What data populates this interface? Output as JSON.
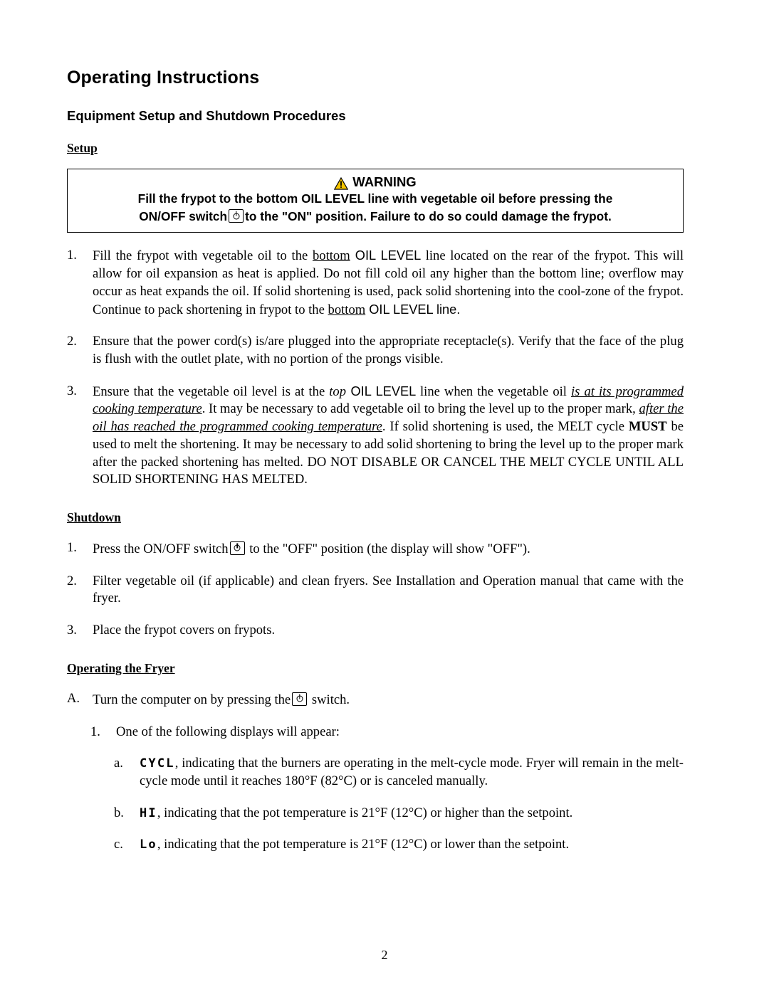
{
  "document": {
    "title": "Operating Instructions",
    "subtitle": "Equipment Setup and Shutdown Procedures",
    "section_setup": "Setup",
    "section_shutdown": "Shutdown",
    "section_operating": "Operating the Fryer",
    "page_number": "2"
  },
  "warning": {
    "heading": "WARNING",
    "icon": "warning-triangle-icon",
    "line1_a": "Fill the frypot to the bottom OIL LEVEL line with vegetable oil before pressing the",
    "line2_a": "ON/OFF switch",
    "line2_b": "to the \"ON\" position.  Failure to do so could damage the frypot."
  },
  "setup_items": [
    {
      "marker": "1.",
      "pre": "Fill the frypot with vegetable oil to the ",
      "u1": "bottom",
      "mid1": " OIL LEVEL ",
      "rest1": "line located on the rear of the frypot. This will allow for oil expansion as heat is applied.  Do not fill cold oil any higher than the bottom line; overflow may occur as heat expands the oil.  If solid shortening is used, pack solid shortening into the cool-zone of the frypot.  Continue to pack shortening in frypot to the ",
      "u2": "bottom",
      "rest2": " OIL LEVEL line."
    },
    {
      "marker": "2.",
      "text": "Ensure that the power cord(s) is/are plugged into the appropriate receptacle(s).  Verify that the face of the plug is flush with the outlet plate, with no portion of the prongs visible."
    },
    {
      "marker": "3.",
      "p1": "Ensure that the vegetable oil level is at the ",
      "i1": "top",
      "p2": " OIL LEVEL ",
      "p3": "line when the vegetable oil ",
      "i2": "is at its programmed cooking temperature",
      "p4": ".  It may be necessary to add vegetable oil to bring the level up to the proper mark, ",
      "i3": "after the oil has reached the programmed cooking temperature",
      "p5": ".  If solid shortening is used, the MELT cycle ",
      "b1": "MUST",
      "p6": " be used to melt the shortening.  It may be necessary to add solid shortening to bring the level up to the proper mark after the packed shortening has melted.   DO NOT DISABLE OR CANCEL THE MELT CYCLE UNTIL ALL SOLID SHORTENING HAS MELTED."
    }
  ],
  "shutdown_items": [
    {
      "marker": "1.",
      "pre": "Press the ON/OFF switch",
      "post": "to the \"OFF\" position (the display will show \"OFF\")."
    },
    {
      "marker": "2.",
      "text": "Filter vegetable oil (if applicable) and clean fryers.  See Installation and Operation manual that came with the fryer."
    },
    {
      "marker": "3.",
      "text": "Place the frypot covers on frypots."
    }
  ],
  "operating_items": {
    "a_marker": "A.",
    "a_pre": "Turn the computer on by pressing the",
    "a_post": "switch.",
    "one_marker": "1.",
    "one_text": "One of the following displays will appear:",
    "sub": [
      {
        "marker": "a.",
        "display": "CYCL",
        "text": ", indicating that the burners are operating in the melt-cycle mode. Fryer will remain in the melt-cycle mode until it reaches 180°F (82°C) or is canceled manually."
      },
      {
        "marker": "b.",
        "display": "HI",
        "text": ", indicating that the pot temperature is 21°F (12°C) or higher than the setpoint."
      },
      {
        "marker": "c.",
        "display": "Lo",
        "text": ", indicating that the pot temperature is 21°F (12°C) or lower than the setpoint."
      }
    ]
  }
}
